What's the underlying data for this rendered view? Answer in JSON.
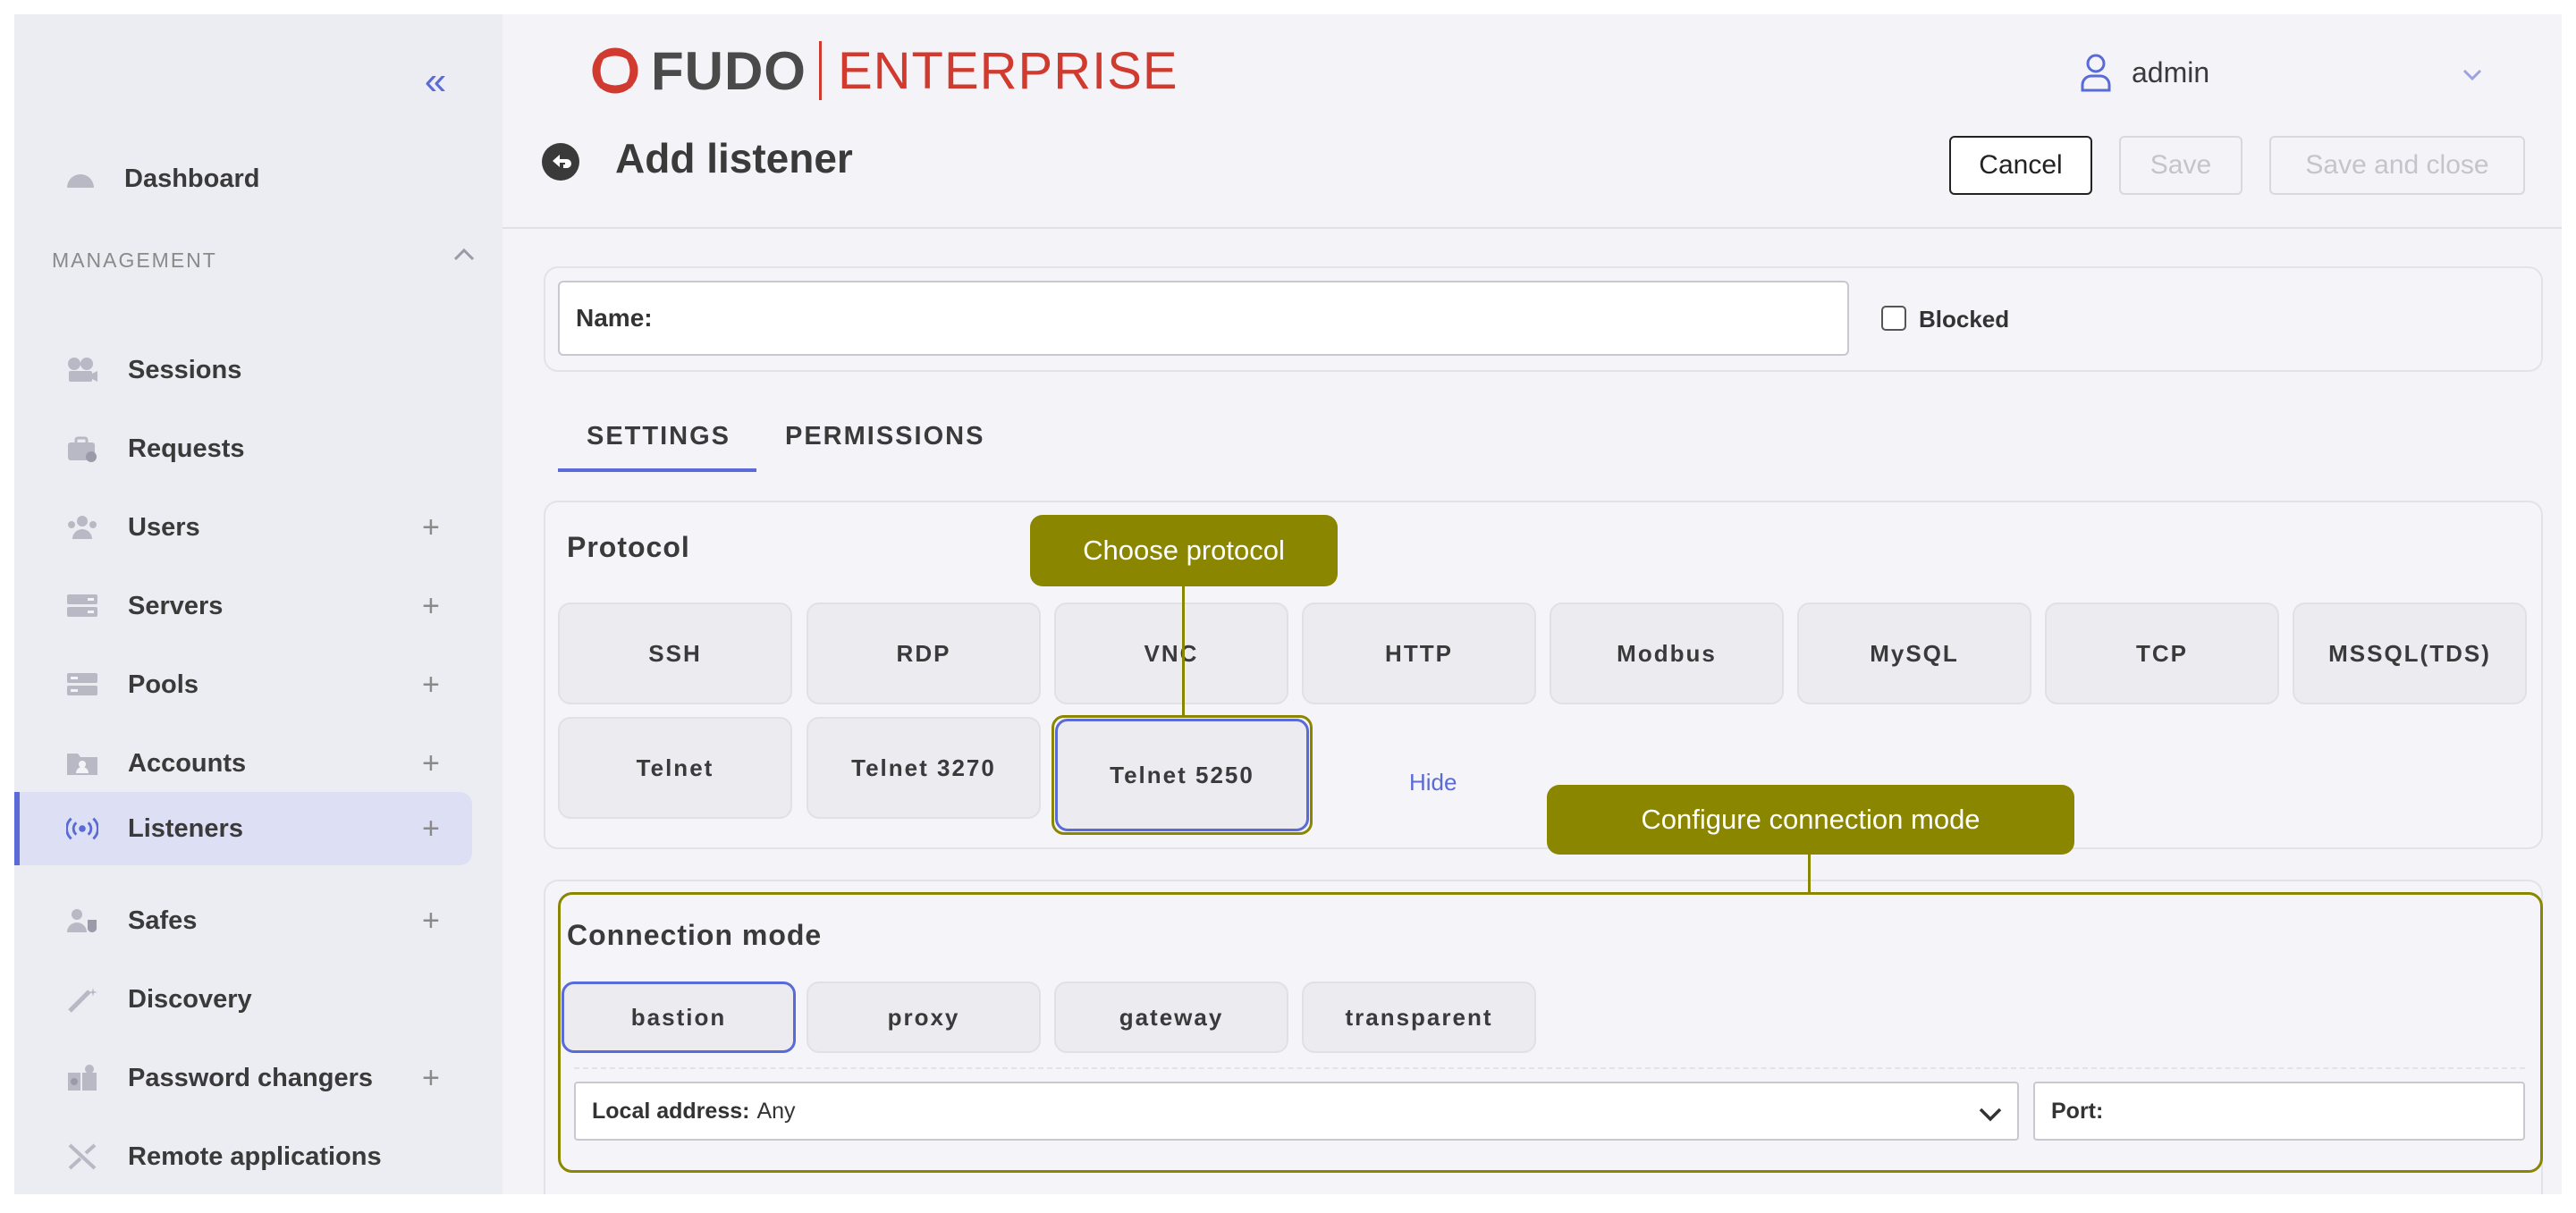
{
  "sidebar": {
    "dashboard": "Dashboard",
    "section_title": "MANAGEMENT",
    "items": [
      {
        "label": "Sessions",
        "plus": ""
      },
      {
        "label": "Requests",
        "plus": ""
      },
      {
        "label": "Users",
        "plus": "+"
      },
      {
        "label": "Servers",
        "plus": "+"
      },
      {
        "label": "Pools",
        "plus": "+"
      },
      {
        "label": "Accounts",
        "plus": "+"
      },
      {
        "label": "Listeners",
        "plus": "+"
      },
      {
        "label": "Safes",
        "plus": "+"
      },
      {
        "label": "Discovery",
        "plus": ""
      },
      {
        "label": "Password changers",
        "plus": "+"
      },
      {
        "label": "Remote applications",
        "plus": ""
      }
    ],
    "active_item": "Listeners"
  },
  "header": {
    "logo_fudo": "FUDO",
    "logo_enterprise": "ENTERPRISE",
    "user_name": "admin"
  },
  "page": {
    "title": "Add listener",
    "cancel": "Cancel",
    "save": "Save",
    "save_and_close": "Save and close"
  },
  "form": {
    "name_label": "Name:",
    "name_value": "",
    "blocked_label": "Blocked",
    "blocked_checked": false
  },
  "tabs": {
    "settings": "SETTINGS",
    "permissions": "PERMISSIONS",
    "active": "SETTINGS"
  },
  "protocol": {
    "title": "Protocol",
    "options": [
      "SSH",
      "RDP",
      "VNC",
      "HTTP",
      "Modbus",
      "MySQL",
      "TCP",
      "MSSQL(TDS)",
      "Telnet",
      "Telnet 3270",
      "Telnet 5250"
    ],
    "selected": "Telnet 5250",
    "hide_link": "Hide"
  },
  "connection": {
    "title": "Connection mode",
    "modes": [
      "bastion",
      "proxy",
      "gateway",
      "transparent"
    ],
    "selected": "bastion",
    "local_address_label": "Local address:",
    "local_address_value": "Any",
    "port_label": "Port:"
  },
  "annotations": {
    "choose_protocol": "Choose protocol",
    "configure_connection": "Configure connection mode"
  },
  "colors": {
    "accent": "#5a6ad6",
    "brand_red": "#d13a2e",
    "annotation": "#8a8600"
  }
}
